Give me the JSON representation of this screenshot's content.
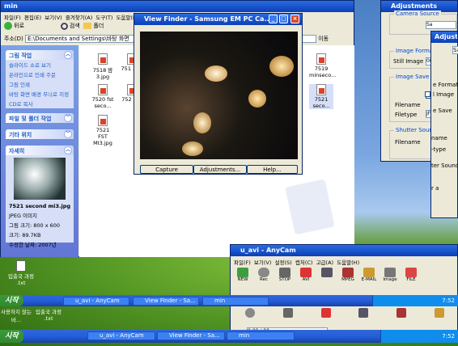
{
  "explorer": {
    "title": "min",
    "menu": [
      "파일(F)",
      "편집(E)",
      "보기(V)",
      "즐겨찾기(A)",
      "도구(T)",
      "도움말(H)"
    ],
    "back": "뒤로",
    "search": "검색",
    "folders": "폴더",
    "address_label": "주소(D)",
    "address": "E:\\Documents and Settings\\바탕 화면",
    "go": "이동",
    "tasks_header": "그림 작업",
    "tasks": [
      "슬라이드 쇼로 보기",
      "온라인으로 인쇄 주문",
      "그림 인쇄",
      "바탕 화면 배경 무늬로 지정",
      "CD로 복사"
    ],
    "file_header": "파일 및 폴더 작업",
    "other_header": "기타 위치",
    "detail_header": "자세히",
    "detail": {
      "name": "7521 second mi3.jpg",
      "type": "JPEG 이미지",
      "dims": "그림 크기: 800 x 600",
      "size": "크기: 89.7KB",
      "modified": "수정한 날짜: 2007년"
    },
    "files": [
      "7518 맘3.jpg",
      "751 323",
      "7520 fst seco...",
      "752 sec",
      "7521 FST MI3.jpg",
      "7519 minseco...",
      "7521 seco..."
    ]
  },
  "viewfinder": {
    "title": "View Finder - Samsung EM PC Ca...",
    "capture": "Capture",
    "adjustments": "Adjustments...",
    "help": "Help..."
  },
  "adjust": {
    "title": "Adjustments",
    "title2": "Adjustments",
    "camera_source": "Camera Source",
    "cs_value": "Sa",
    "image_formats": "Image Formats",
    "still_image": "Still Image",
    "still_value": "00",
    "image_save": "Image Save",
    "e_formats": "e Formats",
    "i_image": "l Image",
    "filename": "Filename",
    "filename_value": "e",
    "filetype": "Filetype",
    "filetype_value": "JF",
    "shutter": "Shutter Sound",
    "sound_filename": "Filename",
    "sound_value": "e",
    "e_save": "e Save",
    "name_lbl": "name",
    "type_lbl": "-type",
    "ter_sound": "ter Sound",
    "r_adv": "r a",
    "jp": "JP",
    "e2": "e"
  },
  "anycam": {
    "title": "u_avi - AnyCam",
    "menu": [
      "파일(F)",
      "보기(V)",
      "설정(S)",
      "캡처(C)",
      "고급(A)",
      "도움말(H)"
    ],
    "tools": [
      "NEW",
      "Rec",
      "STOP",
      "AVI",
      "",
      "MPEG",
      "E-MAIL",
      "Image",
      "FILE"
    ],
    "counter": "0:00 / 00"
  },
  "taskbars": [
    {
      "start": "시작",
      "tasks": [
        "u_avi - AnyCam",
        "View Finder - Sa...",
        "min"
      ],
      "clock": "7:52"
    },
    {
      "start": "시작",
      "tasks": [
        "u_avi - AnyCam",
        "View Finder - Sa...",
        "min"
      ],
      "clock": "7:52"
    }
  ],
  "desktop_icons": [
    {
      "label": "입출국 과정 .txt"
    },
    {
      "label": "사용하지 않는 바..."
    },
    {
      "label": "입출국 과정 .txt"
    }
  ],
  "colors": {
    "xp_blue": "#0a3fb8",
    "close_red": "#d8472b",
    "start_green": "#3c9a3c"
  }
}
